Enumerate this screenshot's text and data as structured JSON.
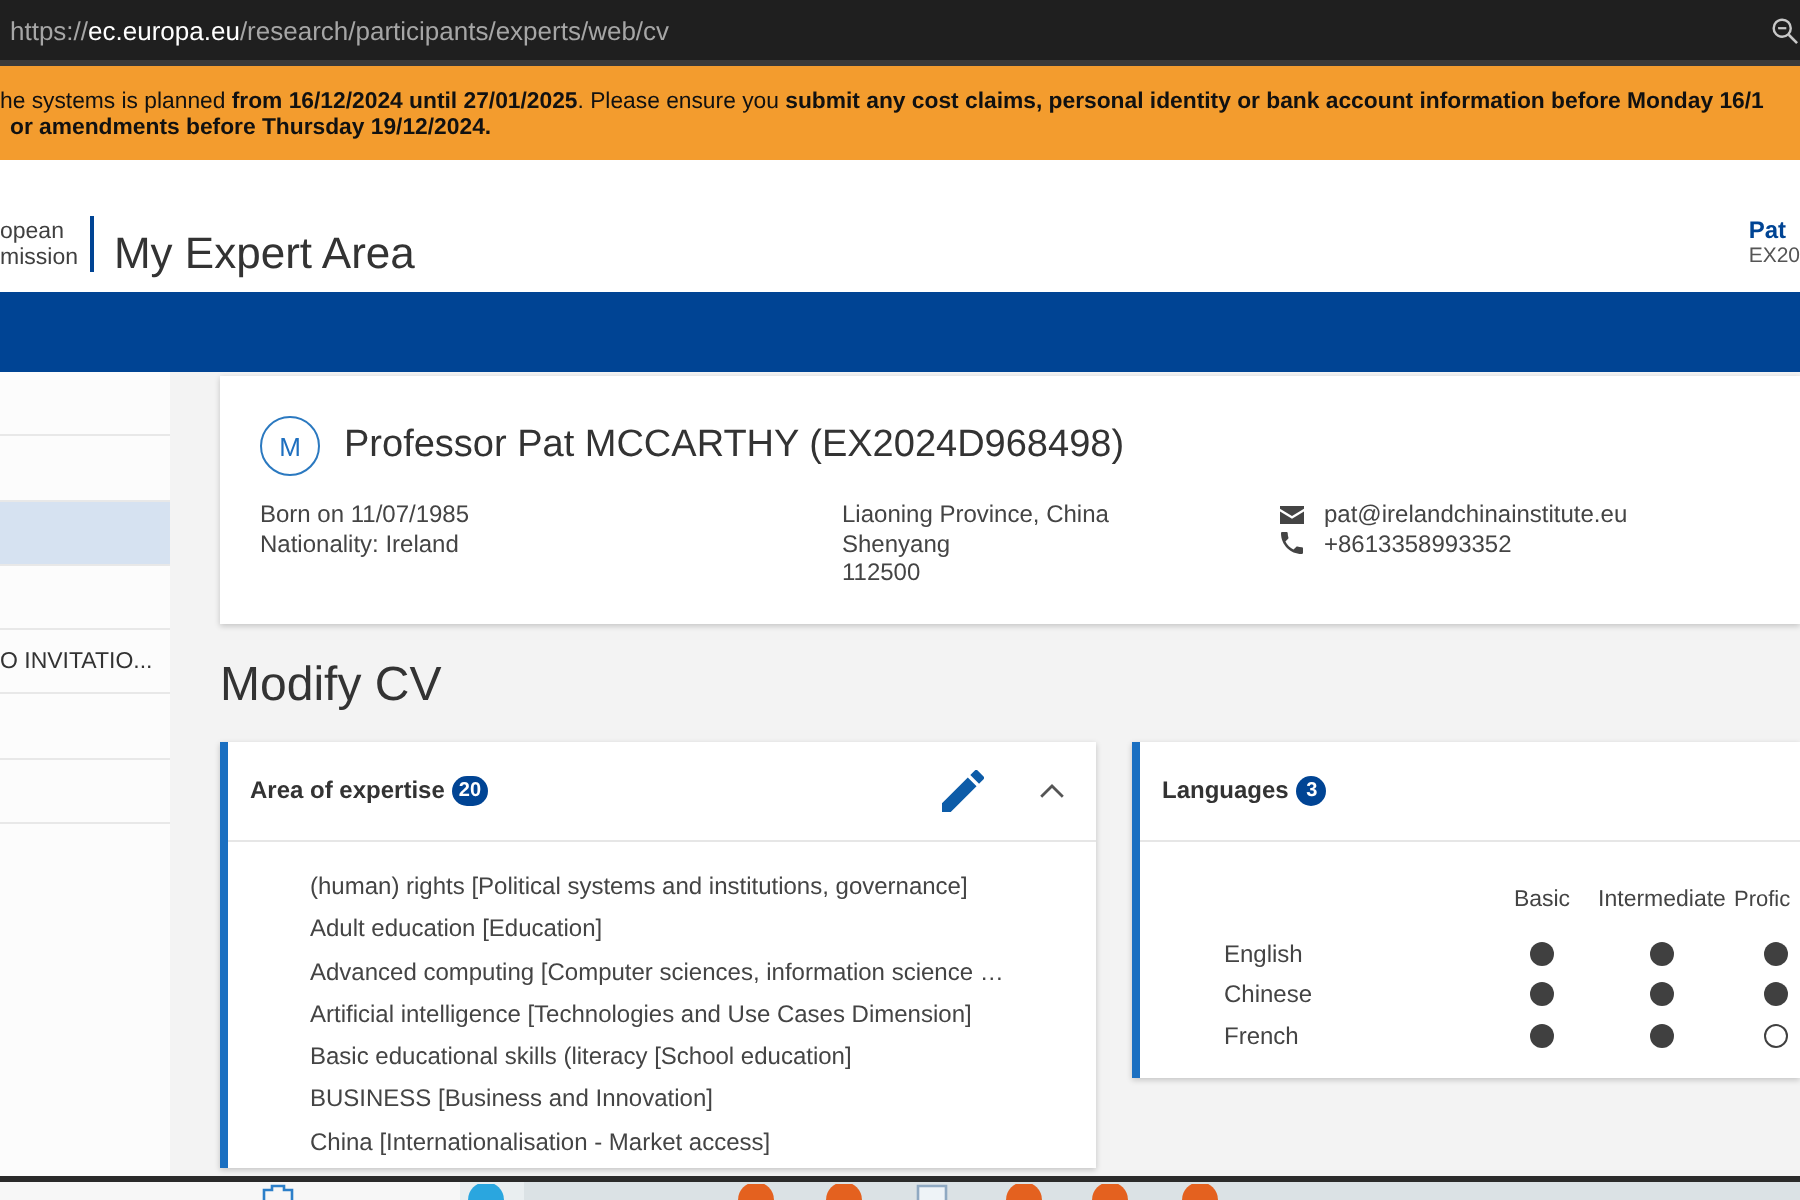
{
  "browser": {
    "url": {
      "scheme": "https://",
      "host": "ec.europa.eu",
      "path": "/research/participants/experts/web/cv"
    }
  },
  "notice": {
    "text": "he systems is planned **from 16/12/2024 until 27/01/2025**. Please ensure you **submit any cost claims, personal identity or bank account information before Monday 16/1**\n**or amendments before Thursday 19/12/2024.**"
  },
  "header": {
    "logo_lines": [
      "opean",
      "mission"
    ],
    "title": "My Expert Area",
    "user": {
      "name": "Pat",
      "id": "EX20"
    }
  },
  "sidebar": {
    "items": [
      {
        "selected": false
      },
      {
        "selected": false
      },
      {
        "selected": true
      },
      {
        "selected": false
      },
      {
        "label": "O INVITATIO...",
        "selected": false
      },
      {
        "selected": false
      },
      {
        "selected": false
      }
    ]
  },
  "profile": {
    "avatar_initial": "M",
    "name": "Professor Pat MCCARTHY (EX2024D968498)",
    "personal": [
      "Born on 11/07/1985",
      "Nationality: Ireland"
    ],
    "address": [
      "Liaoning Province, China",
      "Shenyang",
      "112500"
    ],
    "contacts": [
      {
        "kind": "email",
        "text": "pat@irelandchinainstitute.eu"
      },
      {
        "kind": "phone",
        "text": "+8613358993352"
      }
    ]
  },
  "page_title": "Modify CV",
  "expertise": {
    "title": "Area of expertise",
    "count": "20",
    "expanded": true,
    "items": [
      "(human) rights [Political systems and institutions, governance]",
      "Adult education [Education]",
      "Advanced computing [Computer sciences, information science …",
      "Artificial intelligence [Technologies and Use Cases Dimension]",
      "Basic educational skills (literacy [School education]",
      "BUSINESS [Business and Innovation]",
      "China [Internationalisation - Market access]"
    ]
  },
  "languages": {
    "title": "Languages",
    "count": "3",
    "levels": [
      "Basic",
      "Intermediate",
      "Profic"
    ],
    "rows": [
      {
        "name": "English",
        "marks": [
          true,
          true,
          true
        ]
      },
      {
        "name": "Chinese",
        "marks": [
          true,
          true,
          true
        ]
      },
      {
        "name": "French",
        "marks": [
          true,
          true,
          false
        ]
      }
    ]
  }
}
